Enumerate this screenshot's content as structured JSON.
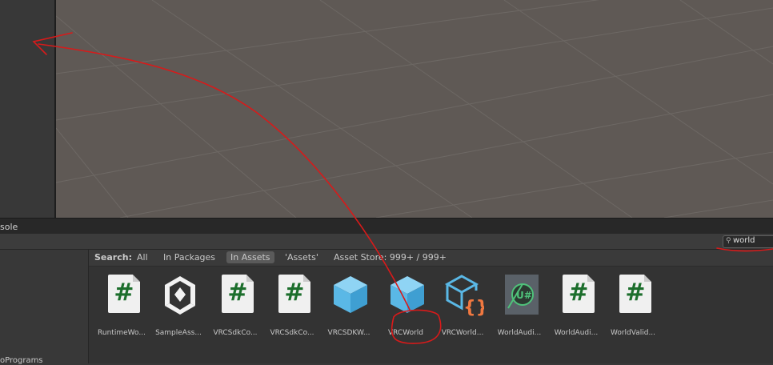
{
  "console": {
    "tab_label": "sole"
  },
  "search": {
    "value": "world",
    "icon": "search-icon"
  },
  "tree": {
    "partial_item": "oPrograms"
  },
  "filter": {
    "label": "Search:",
    "options": [
      "All",
      "In Packages",
      "In Assets",
      "'Assets'",
      "Asset Store: 999+ / 999+"
    ],
    "active": "In Assets"
  },
  "assets": [
    {
      "label": "RuntimeWo...",
      "icon": "csharp-script-icon"
    },
    {
      "label": "SampleAss...",
      "icon": "unity-logo-icon"
    },
    {
      "label": "VRCSdkCo...",
      "icon": "csharp-script-icon"
    },
    {
      "label": "VRCSdkCo...",
      "icon": "csharp-script-icon"
    },
    {
      "label": "VRCSDKW...",
      "icon": "prefab-cube-icon"
    },
    {
      "label": "VRCWorld",
      "icon": "prefab-cube-icon"
    },
    {
      "label": "VRCWorld...",
      "icon": "prefab-variant-braces-icon"
    },
    {
      "label": "WorldAudi...",
      "icon": "udonsharp-icon"
    },
    {
      "label": "WorldAudi...",
      "icon": "csharp-script-icon"
    },
    {
      "label": "WorldValid...",
      "icon": "csharp-script-icon"
    }
  ],
  "colors": {
    "annotation": "#d81a1a",
    "scene_bg": "#5f5955",
    "script_green": "#1c6e2c",
    "cube_blue": "#5ab8e6"
  }
}
